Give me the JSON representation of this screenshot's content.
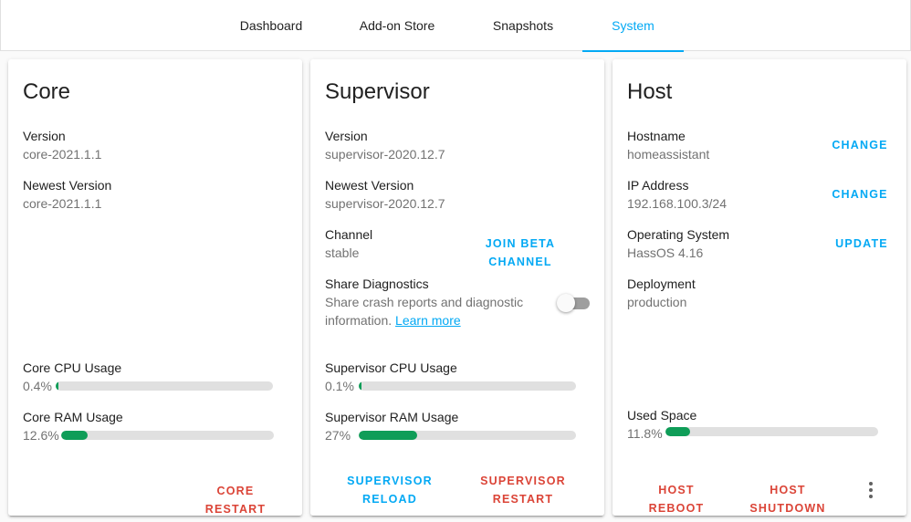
{
  "tabs": [
    {
      "label": "Dashboard"
    },
    {
      "label": "Add-on Store"
    },
    {
      "label": "Snapshots"
    },
    {
      "label": "System"
    }
  ],
  "core": {
    "title": "Core",
    "version_label": "Version",
    "version_value": "core-2021.1.1",
    "newest_label": "Newest Version",
    "newest_value": "core-2021.1.1",
    "cpu_label": "Core CPU Usage",
    "cpu_value": "0.4%",
    "cpu_fraction": 0.004,
    "ram_label": "Core RAM Usage",
    "ram_value": "12.6%",
    "ram_fraction": 0.126,
    "restart_label": "CORE RESTART"
  },
  "supervisor": {
    "title": "Supervisor",
    "version_label": "Version",
    "version_value": "supervisor-2020.12.7",
    "newest_label": "Newest Version",
    "newest_value": "supervisor-2020.12.7",
    "channel_label": "Channel",
    "channel_value": "stable",
    "join_beta_label": "JOIN BETA CHANNEL",
    "diagnostics_label": "Share Diagnostics",
    "diagnostics_desc": "Share crash reports and diagnostic information.",
    "learn_more": "Learn more",
    "diagnostics_enabled": false,
    "cpu_label": "Supervisor CPU Usage",
    "cpu_value": "0.1%",
    "cpu_fraction": 0.001,
    "ram_label": "Supervisor RAM Usage",
    "ram_value": "27%",
    "ram_fraction": 0.27,
    "reload_line1": "SUPERVISOR",
    "reload_line2": "RELOAD",
    "restart_line1": "SUPERVISOR",
    "restart_line2": "RESTART"
  },
  "host": {
    "title": "Host",
    "hostname_label": "Hostname",
    "hostname_value": "homeassistant",
    "hostname_action": "CHANGE",
    "ip_label": "IP Address",
    "ip_value": "192.168.100.3/24",
    "ip_action": "CHANGE",
    "os_label": "Operating System",
    "os_value": "HassOS 4.16",
    "os_action": "UPDATE",
    "deployment_label": "Deployment",
    "deployment_value": "production",
    "space_label": "Used Space",
    "space_value": "11.8%",
    "space_fraction": 0.118,
    "reboot_label": "HOST REBOOT",
    "shutdown_label": "HOST SHUTDOWN",
    "more_icon": "more-vert-icon"
  },
  "colors": {
    "accent": "#03a9f4",
    "danger": "#db4437",
    "bar_fill": "#0f9d58",
    "bar_track": "#e0e0e0"
  }
}
